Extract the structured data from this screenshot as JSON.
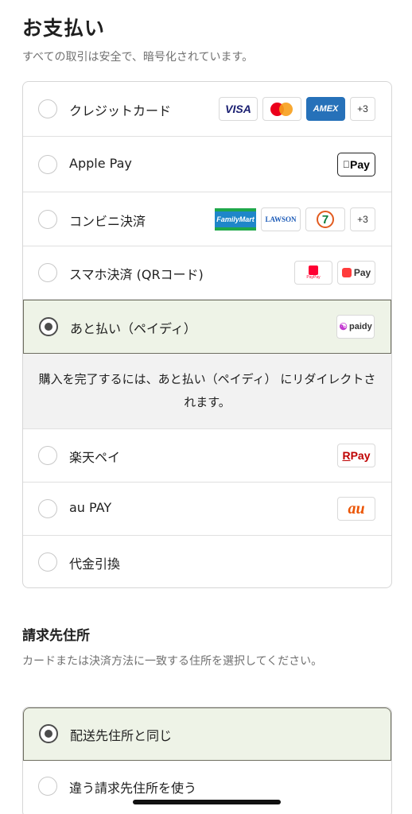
{
  "payment": {
    "title": "お支払い",
    "subtitle": "すべての取引は安全で、暗号化されています。",
    "methods": [
      {
        "label": "クレジットカード",
        "logos": [
          "VISA",
          "mastercard",
          "AMEX",
          "+3"
        ]
      },
      {
        "label": "Apple Pay",
        "logos": [
          "Pay"
        ]
      },
      {
        "label": "コンビニ決済",
        "logos": [
          "FamilyMart",
          "LAWSON",
          "7",
          "+3"
        ]
      },
      {
        "label": "スマホ決済 (QRコード)",
        "logos": [
          "PayPay",
          "Pay"
        ]
      },
      {
        "label": "あと払い（ペイディ）",
        "logos": [
          "paidy"
        ],
        "selected": true
      },
      {
        "label": "楽天ペイ",
        "logos": [
          "Pay"
        ]
      },
      {
        "label": "au PAY",
        "logos": [
          "au"
        ]
      },
      {
        "label": "代金引換",
        "logos": []
      }
    ],
    "paidy_notice": "購入を完了するには、あと払い（ペイディ） にリダイレクトされます。"
  },
  "billing": {
    "title": "請求先住所",
    "subtitle": "カードまたは決済方法に一致する住所を選択してください。",
    "options": [
      {
        "label": "配送先住所と同じ",
        "selected": true
      },
      {
        "label": "違う請求先住所を使う",
        "selected": false
      }
    ]
  },
  "colors": {
    "selected_bg": "#eef3e7",
    "radio_on": "#4c4c4c",
    "border": "#d6d6d6"
  }
}
